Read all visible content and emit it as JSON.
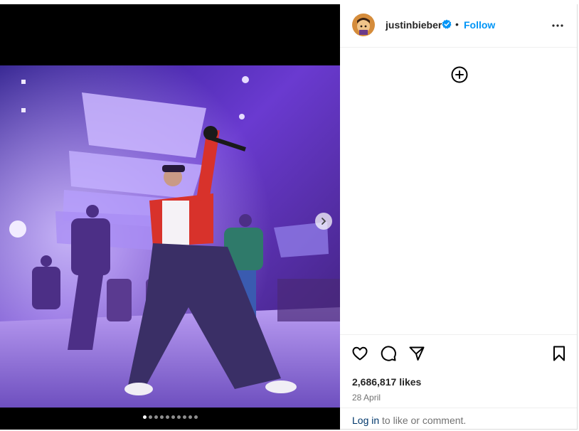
{
  "post": {
    "media_dots": [
      true,
      false,
      false,
      false,
      false,
      false,
      false,
      false,
      false,
      false
    ]
  },
  "header": {
    "username": "justinbieber",
    "separator": "•",
    "follow_label": "Follow",
    "verified": true
  },
  "stats": {
    "likes_count": "2,686,817",
    "likes_suffix": "likes",
    "date": "28 April"
  },
  "login": {
    "link_label": "Log in",
    "rest_text": "to like or comment."
  },
  "icons": {
    "next": "chevron-right-icon",
    "more": "more-options-icon",
    "add": "add-circle-icon",
    "like": "heart-icon",
    "comment": "comment-icon",
    "share": "paper-plane-icon",
    "save": "bookmark-icon",
    "verified": "verified-badge-icon"
  },
  "colors": {
    "accent": "#0095f6",
    "verified": "#0095f6",
    "login_link": "#00376b"
  }
}
